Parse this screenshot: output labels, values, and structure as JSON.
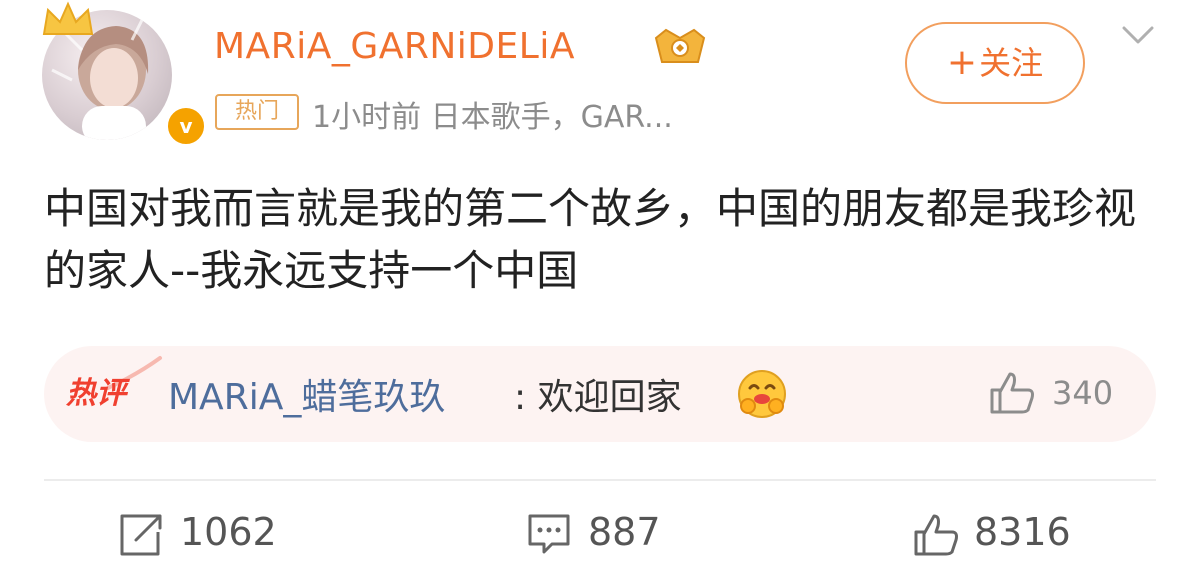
{
  "user": {
    "name": "MARiA_GARNiDELiA",
    "verified_symbol": "v"
  },
  "follow_button": {
    "plus": "+",
    "label": "关注"
  },
  "meta": {
    "tag": "热门",
    "text": "1小时前  日本歌手，GAR..."
  },
  "post": {
    "text": "中国对我而言就是我的第二个故乡，中国的朋友都是我珍视的家人--我永远支持一个中国"
  },
  "hot_comment": {
    "badge": "热评",
    "user": "MARiA_蜡笔玖玖",
    "text": ": 欢迎回家",
    "likes": "340"
  },
  "actions": {
    "reposts": "1062",
    "comments": "887",
    "likes": "8316"
  },
  "colors": {
    "accent": "#f0712f",
    "link": "#4e6d9c",
    "hot_red": "#f04030",
    "hot_comment_bg": "#fdf3f2"
  },
  "icons": [
    "crown-icon",
    "verified-icon",
    "vip-crown-icon",
    "chevron-down-icon",
    "emoji-hug-icon",
    "thumbs-up-icon",
    "repost-icon",
    "comment-icon"
  ]
}
